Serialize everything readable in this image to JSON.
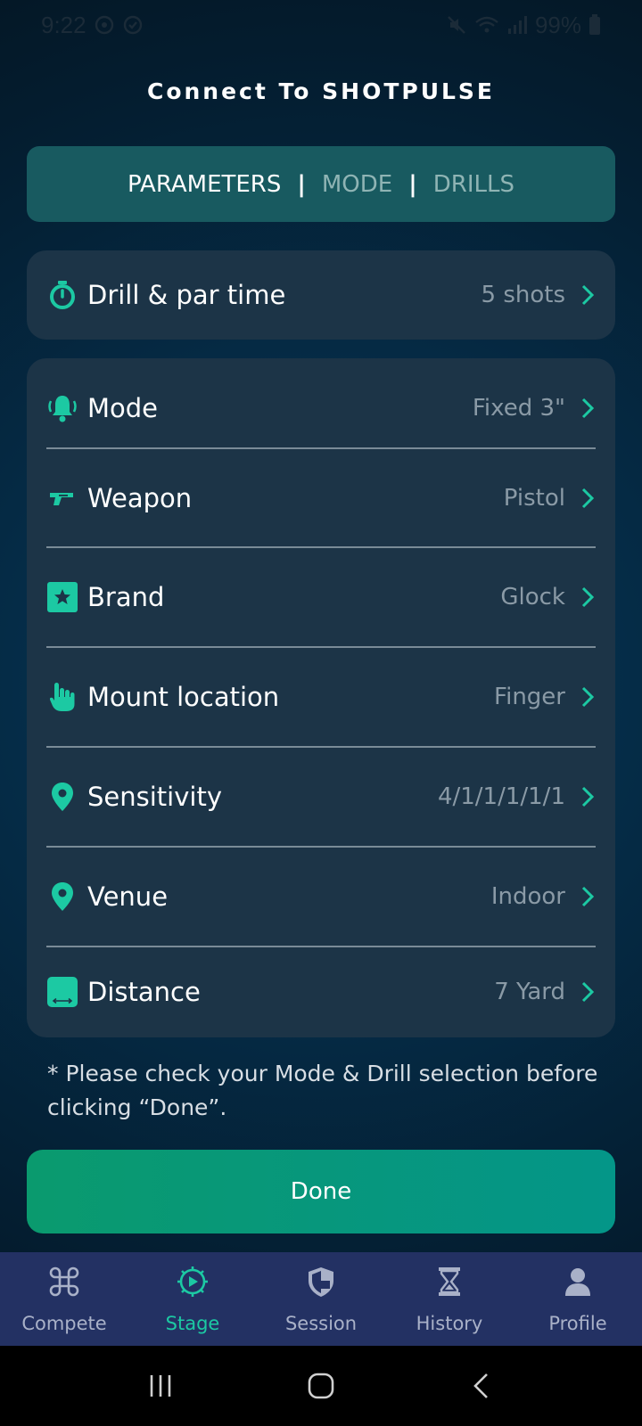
{
  "status_bar": {
    "time": "9:22",
    "battery": "99%"
  },
  "header": {
    "title": "Connect To SHOTPULSE"
  },
  "tabs": [
    {
      "label": "PARAMETERS",
      "active": true
    },
    {
      "label": "MODE",
      "active": false
    },
    {
      "label": "DRILLS",
      "active": false
    }
  ],
  "tab_separator": "|",
  "drill_row": {
    "label": "Drill & par time",
    "value": "5 shots",
    "icon": "stopwatch-icon"
  },
  "settings": [
    {
      "label": "Mode",
      "value": "Fixed 3\"",
      "icon": "bell-icon"
    },
    {
      "label": "Weapon",
      "value": "Pistol",
      "icon": "pistol-icon"
    },
    {
      "label": "Brand",
      "value": "Glock",
      "icon": "star-badge-icon"
    },
    {
      "label": "Mount location",
      "value": "Finger",
      "icon": "hand-icon"
    },
    {
      "label": "Sensitivity",
      "value": "4/1/1/1/1/1",
      "icon": "location-pin-icon"
    },
    {
      "label": "Venue",
      "value": "Indoor",
      "icon": "location-pin-icon"
    },
    {
      "label": "Distance",
      "value": "7 Yard",
      "icon": "distance-icon"
    }
  ],
  "note": {
    "text": "* Please check your Mode & Drill selection before clicking “Done”."
  },
  "done_button": {
    "label": "Done"
  },
  "bottom_nav": [
    {
      "label": "Compete",
      "icon": "command-icon",
      "active": false
    },
    {
      "label": "Stage",
      "icon": "stage-icon",
      "active": true
    },
    {
      "label": "Session",
      "icon": "shield-icon",
      "active": false
    },
    {
      "label": "History",
      "icon": "hourglass-icon",
      "active": false
    },
    {
      "label": "Profile",
      "icon": "person-icon",
      "active": false
    }
  ],
  "colors": {
    "accent": "#1cc9a3",
    "card": "#1c3447",
    "tabs_bg": "#185a60",
    "nav_bg": "#233163",
    "done_button": "#07977c"
  }
}
